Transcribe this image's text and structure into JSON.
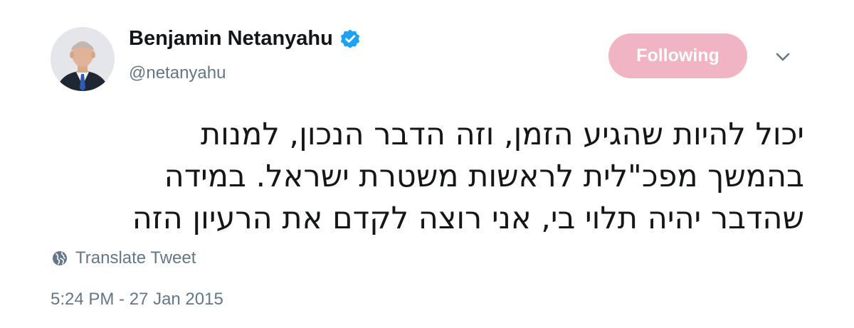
{
  "author": {
    "display_name": "Benjamin Netanyahu",
    "handle": "@netanyahu",
    "verified_icon": "verified-badge-icon"
  },
  "header": {
    "follow_button_label": "Following",
    "menu_icon": "chevron-down-icon"
  },
  "tweet": {
    "lines": [
      "יכול להיות שהגיע הזמן, וזה הדבר הנכון, למנות",
      "בהמשך מפכ\"לית לראשות משטרת ישראל. במידה",
      "שהדבר יהיה תלוי בי, אני רוצה לקדם את הרעיון הזה"
    ]
  },
  "footer": {
    "translate_label": "Translate Tweet",
    "translate_icon": "globe-icon",
    "timestamp": "5:24 PM - 27 Jan 2015"
  },
  "colors": {
    "follow_button_bg": "#f0b4c2",
    "verified_blue": "#1da1f2",
    "secondary_text": "#657786",
    "primary_text": "#14171a"
  }
}
